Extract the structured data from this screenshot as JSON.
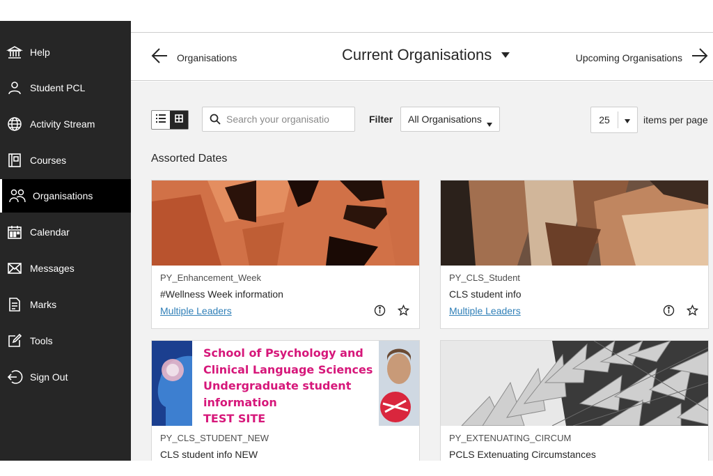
{
  "sidebar": {
    "items": [
      {
        "label": "Help",
        "icon": "bank-icon"
      },
      {
        "label": "Student PCL",
        "icon": "user-icon"
      },
      {
        "label": "Activity Stream",
        "icon": "globe-icon"
      },
      {
        "label": "Courses",
        "icon": "book-icon"
      },
      {
        "label": "Organisations",
        "icon": "people-icon",
        "active": true
      },
      {
        "label": "Calendar",
        "icon": "calendar-icon"
      },
      {
        "label": "Messages",
        "icon": "envelope-icon"
      },
      {
        "label": "Marks",
        "icon": "marks-icon"
      },
      {
        "label": "Tools",
        "icon": "edit-icon"
      },
      {
        "label": "Sign Out",
        "icon": "sign-out-icon"
      }
    ]
  },
  "header": {
    "back_label": "Organisations",
    "title": "Current Organisations",
    "next_label": "Upcoming Organisations"
  },
  "toolbar": {
    "search_placeholder": "Search your organisatio",
    "filter_label": "Filter",
    "filter_value": "All Organisations",
    "per_page_value": "25",
    "per_page_label": "items per page"
  },
  "group": {
    "title": "Assorted Dates"
  },
  "cards": [
    {
      "id": "PY_Enhancement_Week",
      "name": "#Wellness Week information",
      "leaders": "Multiple Leaders"
    },
    {
      "id": "PY_CLS_Student",
      "name": "CLS student info",
      "leaders": "Multiple Leaders"
    },
    {
      "id": "PY_CLS_STUDENT_NEW",
      "name": "CLS student info NEW",
      "leaders": "",
      "banner_lines": [
        "School of Psychology and",
        "Clinical Language Sciences",
        "Undergraduate student",
        "information",
        "TEST SITE"
      ]
    },
    {
      "id": "PY_EXTENUATING_CIRCUM",
      "name": "PCLS Extenuating Circumstances",
      "leaders": ""
    }
  ],
  "colors": {
    "sidebar_bg": "#262626",
    "active_bg": "#000000",
    "content_bg": "#f2f2f2",
    "link": "#2f7fb7",
    "banner_text": "#d6177a"
  }
}
